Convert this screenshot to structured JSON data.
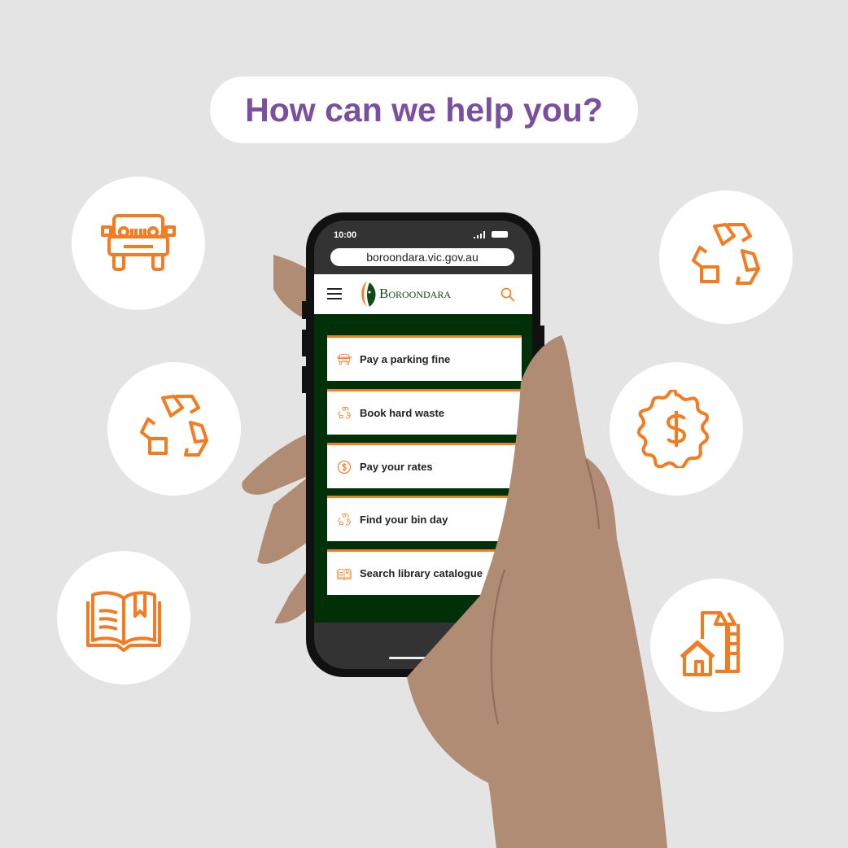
{
  "headline": "How can we help you?",
  "colors": {
    "accent": "#f47b20",
    "headline": "#7b4fa0",
    "site_green": "#003008",
    "background": "#e4e4e4",
    "skin": "#b08c74"
  },
  "side_icons": [
    "jeep-icon",
    "recycle-icon",
    "open-book-icon",
    "recycle-icon",
    "dollar-badge-icon",
    "buildings-icon"
  ],
  "phone": {
    "time": "10:00",
    "url": "boroondara.vic.gov.au",
    "brand": "Boroondara",
    "header_icons": [
      "hamburger-menu-icon",
      "search-icon"
    ],
    "menu_items": [
      {
        "label": "Pay a parking fine",
        "icon": "jeep-icon"
      },
      {
        "label": "Book hard waste",
        "icon": "recycle-icon"
      },
      {
        "label": "Pay your rates",
        "icon": "dollar-coin-icon"
      },
      {
        "label": "Find your bin day",
        "icon": "recycle-icon"
      },
      {
        "label": "Search library catalogue",
        "icon": "book-icon"
      }
    ]
  }
}
